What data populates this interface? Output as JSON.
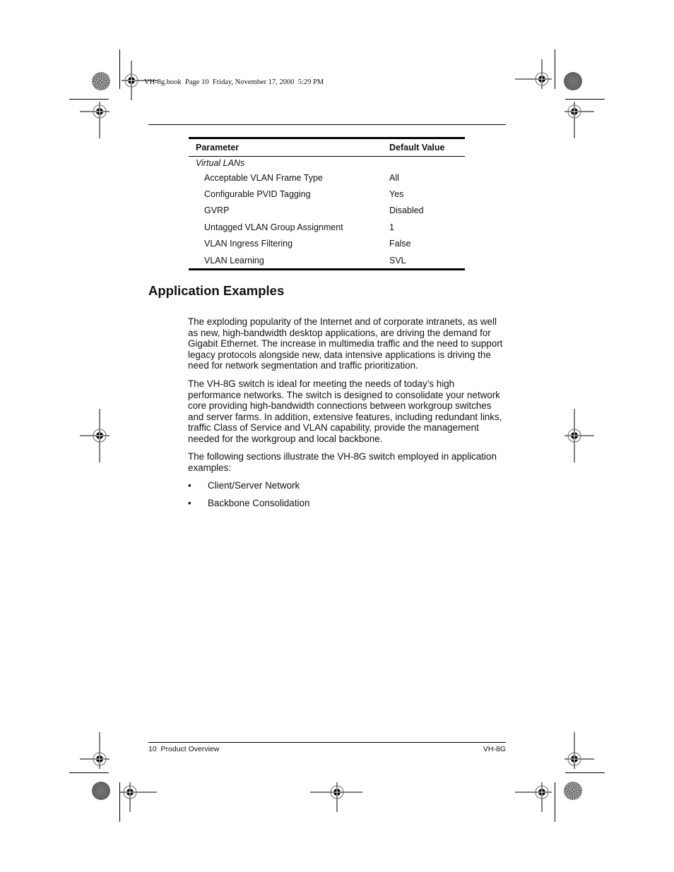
{
  "print_header": "VH-8g.book  Page 10  Friday, November 17, 2000  5:29 PM",
  "table": {
    "headers": [
      "Parameter",
      "Default Value"
    ],
    "group": "Virtual LANs",
    "rows": [
      {
        "parameter": "Acceptable VLAN Frame Type",
        "value": "All"
      },
      {
        "parameter": "Configurable PVID Tagging",
        "value": "Yes"
      },
      {
        "parameter": "GVRP",
        "value": "Disabled"
      },
      {
        "parameter": "Untagged VLAN Group Assignment",
        "value": "1"
      },
      {
        "parameter": "VLAN Ingress Filtering",
        "value": "False"
      },
      {
        "parameter": "VLAN Learning",
        "value": "SVL"
      }
    ]
  },
  "section": {
    "title": "Application Examples",
    "paragraphs": [
      "The exploding popularity of the Internet and of corporate intranets, as well as new, high-bandwidth desktop applications, are driving the demand for Gigabit Ethernet. The increase in multimedia traffic and the need to support legacy protocols alongside new, data intensive applications is driving the need for network segmentation and traffic prioritization.",
      "The VH-8G switch is ideal for meeting the needs of today’s high performance networks. The switch is designed to consolidate your network core providing high-bandwidth connections between workgroup switches and server farms. In addition, extensive features, including redundant links, traffic Class of Service and VLAN capability, provide the management needed for the workgroup and local backbone.",
      "The following sections illustrate the VH-8G switch employed in application examples:"
    ],
    "bullet_glyph": "•",
    "bullets": [
      "Client/Server Network",
      "Backbone Consolidation"
    ]
  },
  "footer": {
    "left": "10  Product Overview",
    "right": "VH-8G"
  },
  "marks": {
    "registration_icon": "crosshair-registration-mark",
    "color_bar_icon": "press-color-dot"
  }
}
